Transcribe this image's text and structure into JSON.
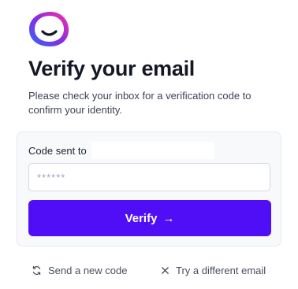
{
  "brand": {
    "logo_icon": "smiley-blob-logo",
    "gradient_colors": [
      "#2d6bff",
      "#8a2be2",
      "#ff2fa8"
    ]
  },
  "header": {
    "title": "Verify your email",
    "subtitle": "Please check your inbox for a verification code to confirm your identity."
  },
  "form": {
    "code_label": "Code sent to",
    "code_placeholder": "******",
    "code_value": "",
    "verify_label": "Verify",
    "verify_icon": "arrow-right-icon",
    "accent_color": "#4f0ef5"
  },
  "footer": {
    "resend_label": "Send a new code",
    "resend_icon": "refresh-icon",
    "different_email_label": "Try a different email",
    "different_email_icon": "close-icon"
  }
}
